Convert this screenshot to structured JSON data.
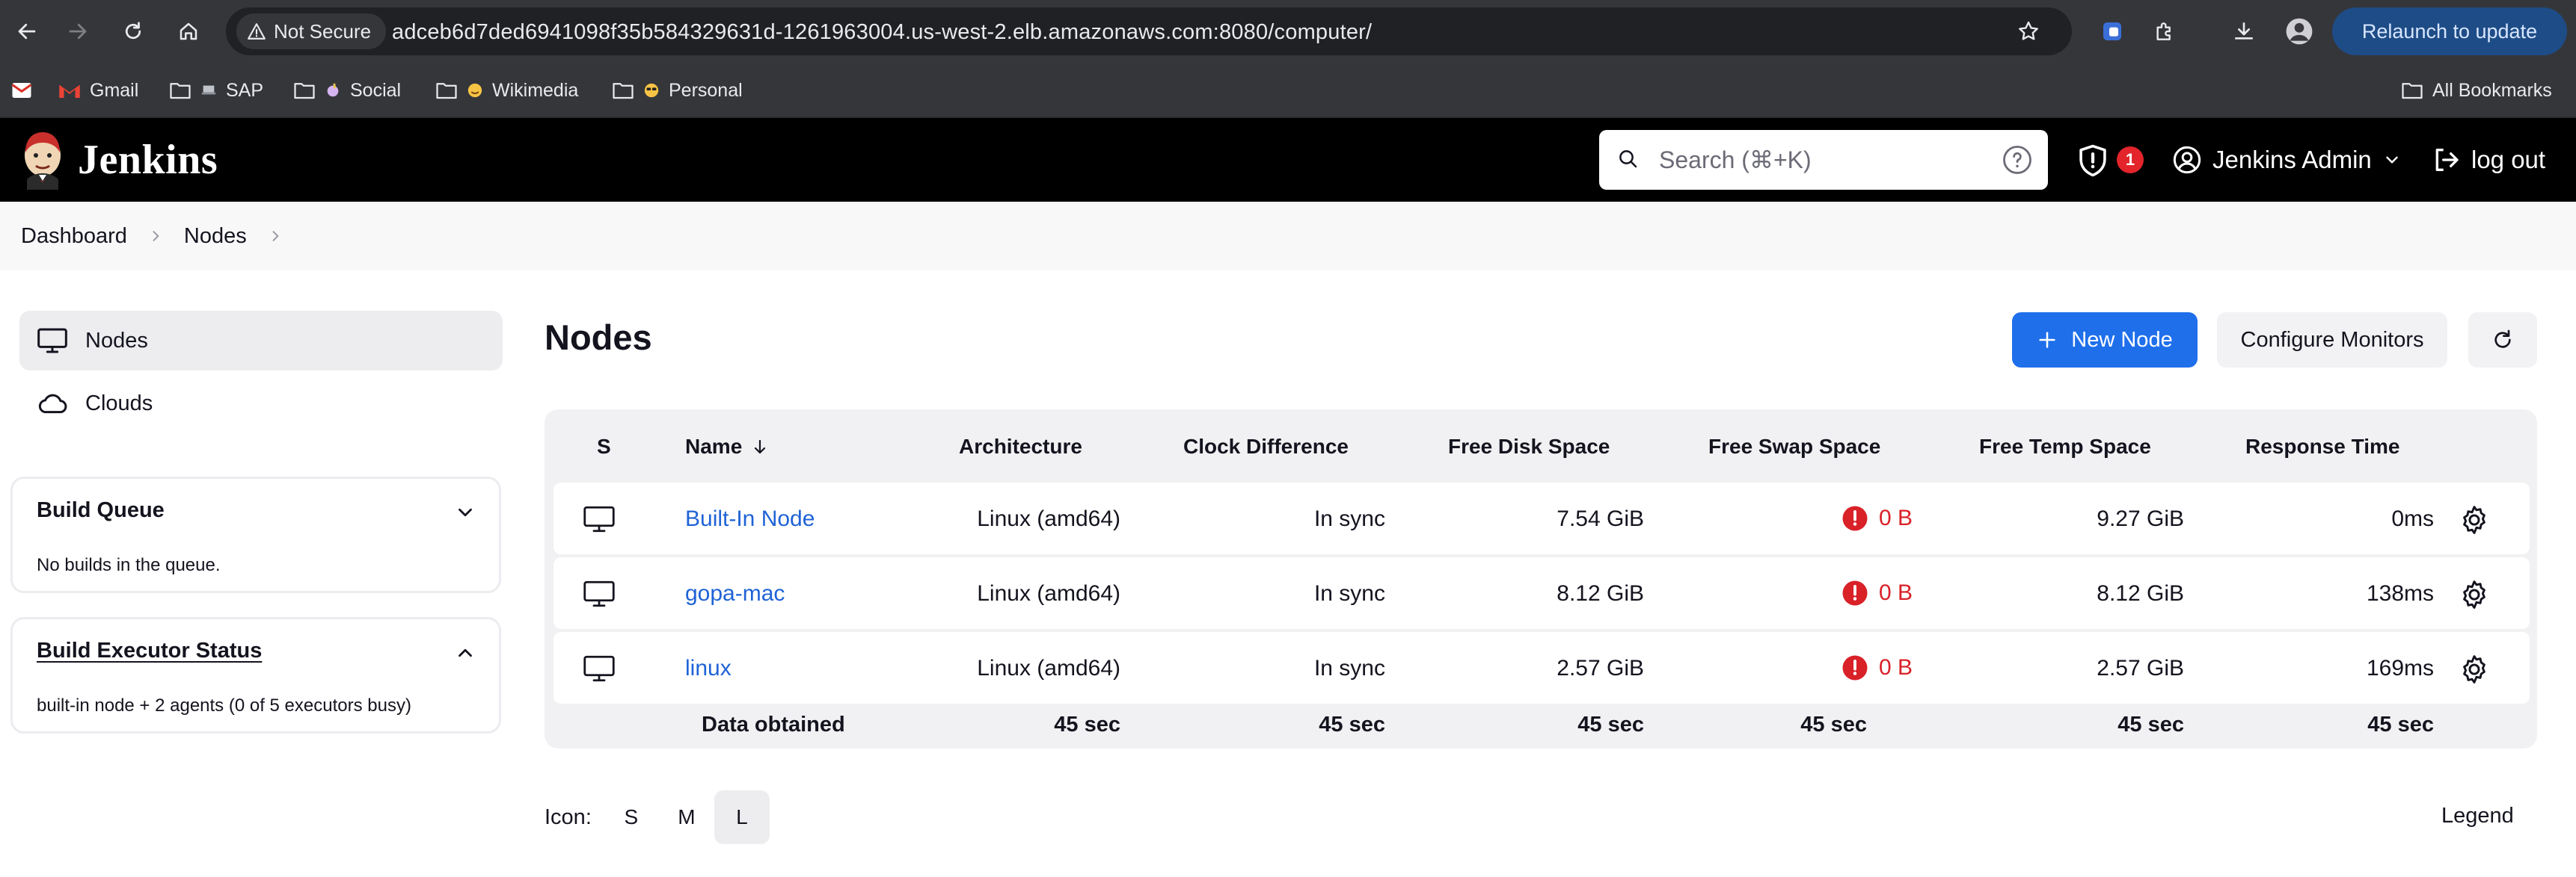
{
  "browser": {
    "security_label": "Not Secure",
    "url": "adceb6d7ded6941098f35b584329631d-1261963004.us-west-2.elb.amazonaws.com:8080/computer/",
    "relaunch_label": "Relaunch to update",
    "bookmarks": [
      {
        "label": "Gmail"
      },
      {
        "label": "SAP"
      },
      {
        "label": "Social"
      },
      {
        "label": "Wikimedia"
      },
      {
        "label": "Personal"
      }
    ],
    "all_bookmarks_label": "All Bookmarks"
  },
  "header": {
    "brand": "Jenkins",
    "search_placeholder": "Search (⌘+K)",
    "security_count": "1",
    "user_name": "Jenkins Admin",
    "logout_label": "log out"
  },
  "breadcrumb": {
    "items": [
      "Dashboard",
      "Nodes"
    ]
  },
  "sidebar": {
    "items": [
      {
        "label": "Nodes",
        "icon": "monitor-icon"
      },
      {
        "label": "Clouds",
        "icon": "cloud-icon"
      }
    ],
    "build_queue": {
      "title": "Build Queue",
      "body": "No builds in the queue."
    },
    "executor_status": {
      "title": "Build Executor Status",
      "body": "built-in node + 2 agents (0 of 5 executors busy)"
    }
  },
  "main": {
    "title": "Nodes",
    "new_node_label": "New Node",
    "configure_monitors_label": "Configure Monitors",
    "table": {
      "headers": [
        "S",
        "Name",
        "Architecture",
        "Clock Difference",
        "Free Disk Space",
        "Free Swap Space",
        "Free Temp Space",
        "Response Time"
      ],
      "rows": [
        {
          "name": "Built-In Node",
          "arch": "Linux (amd64)",
          "clock": "In sync",
          "disk": "7.54 GiB",
          "swap": "0 B",
          "temp": "9.27 GiB",
          "response": "0ms"
        },
        {
          "name": "gopa-mac",
          "arch": "Linux (amd64)",
          "clock": "In sync",
          "disk": "8.12 GiB",
          "swap": "0 B",
          "temp": "8.12 GiB",
          "response": "138ms"
        },
        {
          "name": "linux",
          "arch": "Linux (amd64)",
          "clock": "In sync",
          "disk": "2.57 GiB",
          "swap": "0 B",
          "temp": "2.57 GiB",
          "response": "169ms"
        }
      ],
      "footer": {
        "label": "Data obtained",
        "values": [
          "45 sec",
          "45 sec",
          "45 sec",
          "45 sec",
          "45 sec",
          "45 sec"
        ]
      }
    },
    "icon_size": {
      "label": "Icon:",
      "options": [
        "S",
        "M",
        "L"
      ],
      "selected": "L"
    },
    "legend_label": "Legend"
  },
  "colors": {
    "accent": "#1f6feb",
    "link": "#1f63d6",
    "error": "#d92128",
    "header_bg": "#000000"
  }
}
